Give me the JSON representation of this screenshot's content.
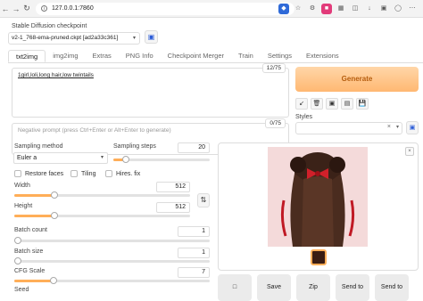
{
  "browser": {
    "url": "127.0.0.1:7860",
    "nav_back_icon": "arrow-left-icon",
    "nav_forward_icon": "arrow-right-icon",
    "reload_icon": "reload-icon"
  },
  "checkpoint": {
    "label": "Stable Diffusion checkpoint",
    "value": "v2-1_768-ema-pruned.ckpt [ad2a33c361]"
  },
  "tabs": [
    "txt2img",
    "img2img",
    "Extras",
    "PNG Info",
    "Checkpoint Merger",
    "Train",
    "Settings",
    "Extensions"
  ],
  "prompt": {
    "text": "1girl,loli,long hair,low twintails",
    "counter": "12/75"
  },
  "negative_prompt": {
    "placeholder": "Negative prompt (press Ctrl+Enter or Alt+Enter to generate)",
    "counter": "0/75"
  },
  "generate_label": "Generate",
  "styles": {
    "label": "Styles",
    "value": ""
  },
  "sampling": {
    "method_label": "Sampling method",
    "method_value": "Euler a",
    "steps_label": "Sampling steps",
    "steps_value": "20"
  },
  "checkboxes": {
    "restore_faces": "Restore faces",
    "tiling": "Tiling",
    "hires_fix": "Hires. fix"
  },
  "width": {
    "label": "Width",
    "value": "512"
  },
  "height": {
    "label": "Height",
    "value": "512"
  },
  "batch_count": {
    "label": "Batch count",
    "value": "1"
  },
  "batch_size": {
    "label": "Batch size",
    "value": "1"
  },
  "cfg_scale": {
    "label": "CFG Scale",
    "value": "7"
  },
  "seed": {
    "label": "Seed"
  },
  "output_buttons": [
    "Save",
    "Zip",
    "Send to",
    "Send to"
  ],
  "slider_levels": {
    "sampling_steps": 0.13,
    "width": 0.23,
    "height": 0.23,
    "batch_count": 0.0,
    "batch_size": 0.0,
    "cfg_scale": 0.2
  },
  "colors": {
    "accent": "#ffae58",
    "generate_bg": "#ffc98f",
    "generate_text": "#b55d0e"
  }
}
